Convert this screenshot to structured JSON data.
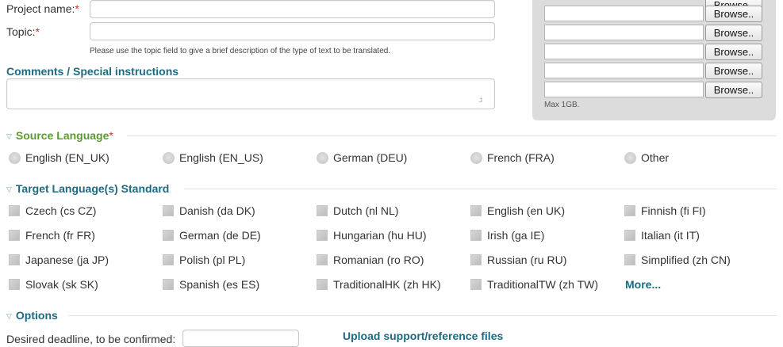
{
  "form": {
    "project_name_label": "Project name:",
    "topic_label": "Topic:",
    "required_mark": "*",
    "topic_hint": "Please use the topic field to give a brief description of the type of text to be translated.",
    "comments_title": "Comments / Special instructions"
  },
  "upload": {
    "browse_label": "Browse..",
    "max_note": "Max 1GB."
  },
  "source_language": {
    "title": "Source Language",
    "required_mark": "*",
    "options": [
      "English (EN_UK)",
      "English (EN_US)",
      "German (DEU)",
      "French (FRA)",
      "Other"
    ]
  },
  "target_languages": {
    "title": "Target Language(s) Standard",
    "rows": [
      [
        "Czech (cs CZ)",
        "Danish (da DK)",
        "Dutch (nl NL)",
        "English (en UK)",
        "Finnish (fi FI)"
      ],
      [
        "French (fr FR)",
        "German (de DE)",
        "Hungarian (hu HU)",
        "Irish (ga IE)",
        "Italian (it IT)"
      ],
      [
        "Japanese (ja JP)",
        "Polish (pl PL)",
        "Romanian (ro RO)",
        "Russian (ru RU)",
        "Simplified (zh CN)"
      ],
      [
        "Slovak (sk SK)",
        "Spanish (es ES)",
        "TraditionalHK (zh HK)",
        "TraditionalTW (zh TW)"
      ]
    ],
    "more_label": "More..."
  },
  "options": {
    "title": "Options",
    "deadline_label": "Desired deadline, to be confirmed:",
    "reference_title": "Upload support/reference files"
  }
}
